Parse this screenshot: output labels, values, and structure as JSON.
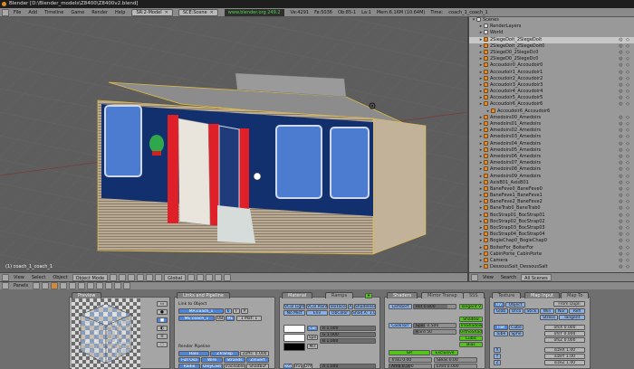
{
  "window": {
    "title": "Blender [D:\\Blender_models\\Z8400\\Z8400v2.blend]"
  },
  "menu": {
    "items": [
      "File",
      "Add",
      "Timeline",
      "Game",
      "Render",
      "Help"
    ],
    "screen_select": "SR:2-Model",
    "scene_select": "SCE:Scene",
    "site": "www.blender.org 249.2",
    "stats": [
      "Ve:4291",
      "Fa:5036",
      "Ob:85-1",
      "La:1",
      "Mem:6.16M (10.64M)",
      "Time:",
      "coach_1_coach_1"
    ]
  },
  "viewport": {
    "object_name": "(1) coach_1_coach_1"
  },
  "view3d_header": {
    "menus": [
      "View",
      "Select",
      "Object"
    ],
    "mode": "Object Mode",
    "pivot": "Global"
  },
  "outliner": {
    "root": "Scenes",
    "rows": [
      {
        "label": "RenderLayers",
        "icons": "",
        "type": "scene",
        "indent": 1
      },
      {
        "label": "World",
        "icons": "",
        "type": "scene",
        "indent": 1
      },
      {
        "label": "2SiegeDoit_2SiegeDoit",
        "icons": "◎ ◇",
        "type": "obj",
        "indent": 1,
        "hl": true
      },
      {
        "label": "2SiegeDoit_2SiegeDoit0",
        "icons": "◎ ◇",
        "type": "obj",
        "indent": 1
      },
      {
        "label": "2SiegeD0_2SiegeDc0",
        "icons": "◎ ◇",
        "type": "obj",
        "indent": 1
      },
      {
        "label": "2SiegeD0_2SiegeDc0",
        "icons": "◎ ◇",
        "type": "obj",
        "indent": 1
      },
      {
        "label": "Accoudoir0_Accoudoir0",
        "icons": "◎ ◇",
        "type": "obj",
        "indent": 1
      },
      {
        "label": "Accoudoir1_Accoudoir1",
        "icons": "◎ ◇",
        "type": "obj",
        "indent": 1
      },
      {
        "label": "Accoudoir2_Accoudoir2",
        "icons": "◎ ◇",
        "type": "obj",
        "indent": 1
      },
      {
        "label": "Accoudoir3_Accoudoir3",
        "icons": "◎ ◇",
        "type": "obj",
        "indent": 1
      },
      {
        "label": "Accoudoir4_Accoudoir4",
        "icons": "◎ ◇",
        "type": "obj",
        "indent": 1
      },
      {
        "label": "Accoudoir5_Accoudoir5",
        "icons": "◎ ◇",
        "type": "obj",
        "indent": 1
      },
      {
        "label": "Accoudoir6_Accoudoir6",
        "icons": "◎ ◇",
        "type": "obj",
        "indent": 1
      },
      {
        "label": "Accoudoir6_Accoudoir6",
        "icons": "",
        "type": "obj",
        "indent": 2
      },
      {
        "label": "Amedoirs00_Amedoirs",
        "icons": "◎ ◇",
        "type": "obj",
        "indent": 1
      },
      {
        "label": "Amedoirs01_Amedoirs",
        "icons": "◎ ◇",
        "type": "obj",
        "indent": 1
      },
      {
        "label": "Amedoirs02_Amedoirs",
        "icons": "◎ ◇",
        "type": "obj",
        "indent": 1
      },
      {
        "label": "Amedoirs03_Amedoirs",
        "icons": "◎ ◇",
        "type": "obj",
        "indent": 1
      },
      {
        "label": "Amedoirs04_Amedoirs",
        "icons": "◎ ◇",
        "type": "obj",
        "indent": 1
      },
      {
        "label": "Amedoirs05_Amedoirs",
        "icons": "◎ ◇",
        "type": "obj",
        "indent": 1
      },
      {
        "label": "Amedoirs06_Amedoirs",
        "icons": "◎ ◇",
        "type": "obj",
        "indent": 1
      },
      {
        "label": "Amedoirs07_Amedoirs",
        "icons": "◎ ◇",
        "type": "obj",
        "indent": 1
      },
      {
        "label": "Amedoirs08_Amedoirs",
        "icons": "◎ ◇",
        "type": "obj",
        "indent": 1
      },
      {
        "label": "Amedoirs09_Amedoirs",
        "icons": "◎ ◇",
        "type": "obj",
        "indent": 1
      },
      {
        "label": "AxisB01_AxisB01",
        "icons": "◎ ◇",
        "type": "obj",
        "indent": 1
      },
      {
        "label": "BaneFeve0_BaneFeve0",
        "icons": "◎ ◇",
        "type": "obj",
        "indent": 1
      },
      {
        "label": "BaneFeve1_BaneFeve1",
        "icons": "◎ ◇",
        "type": "obj",
        "indent": 1
      },
      {
        "label": "BaneFeve2_BaneFeve2",
        "icons": "◎ ◇",
        "type": "obj",
        "indent": 1
      },
      {
        "label": "BaneTrab0_BaneTrab0",
        "icons": "◎ ◇",
        "type": "obj",
        "indent": 1
      },
      {
        "label": "BocStrap01_BocStrap01",
        "icons": "◎ ◇",
        "type": "obj",
        "indent": 1
      },
      {
        "label": "BocStrap02_BocStrap02",
        "icons": "◎ ◇",
        "type": "obj",
        "indent": 1
      },
      {
        "label": "BocStrap03_BocStrap03",
        "icons": "◎ ◇",
        "type": "obj",
        "indent": 1
      },
      {
        "label": "BocStrap04_BocStrap04",
        "icons": "◎ ◇",
        "type": "obj",
        "indent": 1
      },
      {
        "label": "BogieChap0_BogieChap0",
        "icons": "◎ ◇",
        "type": "obj",
        "indent": 1
      },
      {
        "label": "BoiterFor_BoiterFor",
        "icons": "◎ ◇",
        "type": "obj",
        "indent": 1
      },
      {
        "label": "CabinPorte_CabinPorte",
        "icons": "◎ ◇",
        "type": "obj",
        "indent": 1
      },
      {
        "label": "Camera",
        "icons": "◎ ◇",
        "type": "obj",
        "indent": 1
      },
      {
        "label": "DessousSalt_DessousSalt",
        "icons": "◎ ◇",
        "type": "obj",
        "indent": 1
      }
    ]
  },
  "outliner_header": {
    "menus": [
      "View",
      "Search"
    ],
    "filter": "All Scenes"
  },
  "buttons_header": {
    "label": "Panels"
  },
  "panels": {
    "preview": {
      "tab": "Preview"
    },
    "links": {
      "tab": "Links and Pipeline",
      "link_to_object": "Link to Object",
      "material_name": "MA:coach_1",
      "users": "6",
      "me": "ME:coach_1",
      "ob": "OB",
      "me_btn": "ME",
      "mat_count": "1 Mat: 1",
      "render_pipeline": "Render Pipeline",
      "halo": "Halo",
      "ztransp": "ZTransp",
      "zoffs": "Zoffs: 0.000",
      "full_osa": "Full Osa",
      "wire": "Wire",
      "strands": "Strands",
      "zinvert": "ZInvert",
      "radio": "Radio",
      "onlycast": "OnlyCast",
      "traceable": "Traceable",
      "shadbuf": "Shadbuf"
    },
    "material": {
      "tab": "Material",
      "tab2": "Ramps",
      "vcol_light": "VCol Light",
      "vcol_paint": "VCol Paint",
      "texface": "TexFace",
      "a": "A",
      "shadeless": "Shadeless",
      "no_mist": "No Mist",
      "env": "Env",
      "obcolor": "ObColor",
      "shad_a": "Shad A: 1.00",
      "col": "Col",
      "spe": "Spe",
      "mir": "Mir",
      "rgb": "RGB",
      "hsv": "HSV",
      "dyn": "DYN",
      "r": "R 1.000",
      "g": "G 1.000",
      "b": "B 1.000",
      "alpha": "A 1.000"
    },
    "shaders": {
      "tab": "Shaders",
      "tab2": "Mirror Transp",
      "tab3": "SSS",
      "lambert": "Lambert",
      "ref": "Ref 0.800",
      "tangent_v": "Tangent V",
      "cooktorr": "CookTorr",
      "spec": "Spec 0.500",
      "hard": "Hard 50",
      "shadow": "Shadow",
      "tra_shadow": "TraShadow",
      "ortho_shad": "OrthoShad",
      "cubic": "Cubic",
      "bias": "Bias",
      "gr": "GR",
      "exclusive": "Exclusive",
      "tralu": "Tralu 0.00",
      "amb": "Amb 0.500",
      "emit": "Emit 0.000",
      "sbias": "SBias 0.00",
      "shad_a": "Shad A 1.000",
      "lbias": "LBias 0"
    },
    "textures": {
      "tab": "Texture",
      "tab2": "Map Input",
      "tab3": "Map To",
      "uv": "UV",
      "object": "Object",
      "glob": "Glob",
      "orco": "Orco",
      "stick": "Stick",
      "win": "Win",
      "nor": "Nor",
      "refl": "Refl",
      "stress": "Stress",
      "tangent": "Tangent",
      "flat": "Flat",
      "cube": "Cube",
      "tube": "Tube",
      "sphe": "Sphe",
      "from_dupli": "From Dupli",
      "ofsx": "ofsX 0.000",
      "ofsy": "ofsY 0.000",
      "ofsz": "ofsZ 0.000",
      "sizex": "sizeX 1.00",
      "sizey": "sizeY 1.00",
      "sizez": "sizeZ 1.00",
      "x": "X",
      "y": "Y",
      "z": "Z"
    }
  }
}
